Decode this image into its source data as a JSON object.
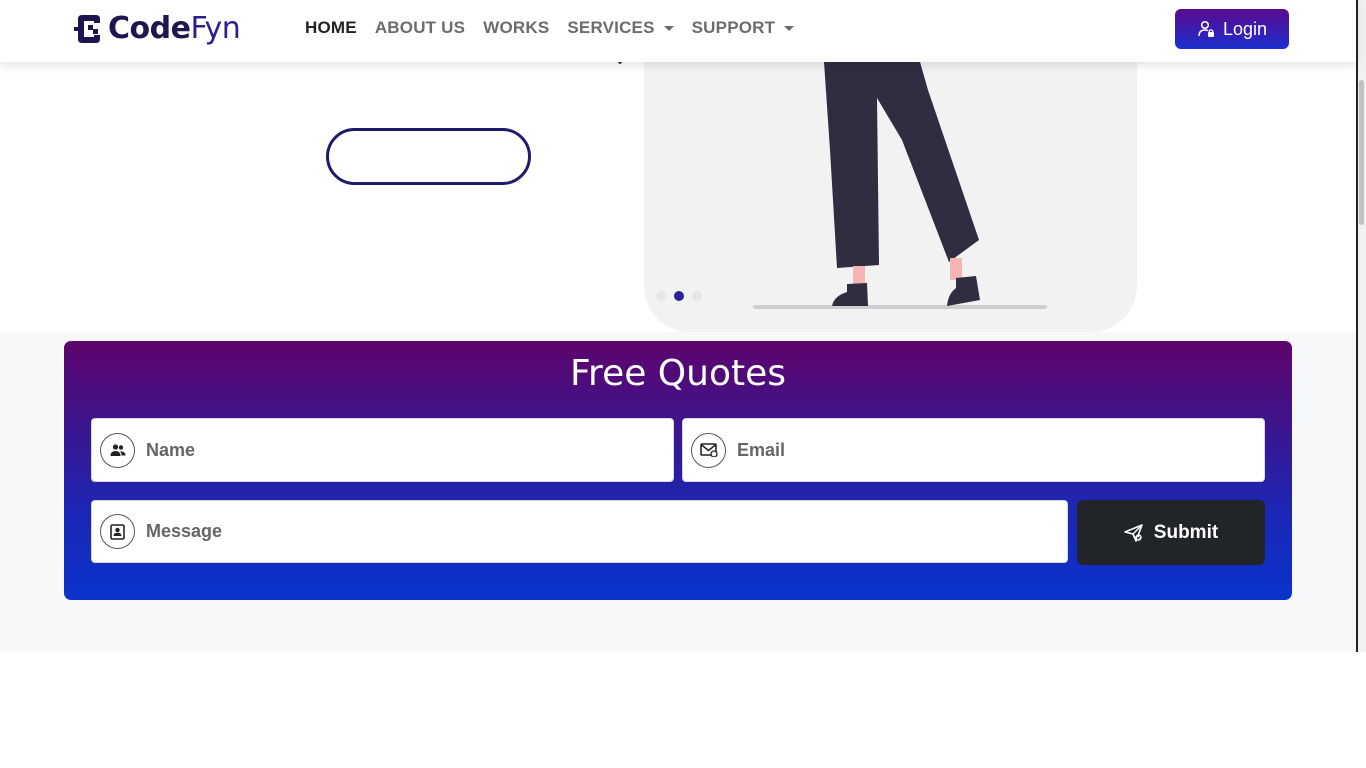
{
  "brand": {
    "name_part1": "Code",
    "name_part2": "Fyn"
  },
  "nav": {
    "items": [
      {
        "label": "HOME",
        "active": true,
        "dropdown": false
      },
      {
        "label": "ABOUT US",
        "active": false,
        "dropdown": false
      },
      {
        "label": "WORKS",
        "active": false,
        "dropdown": false
      },
      {
        "label": "SERVICES",
        "active": false,
        "dropdown": true
      },
      {
        "label": "SUPPORT",
        "active": false,
        "dropdown": true
      }
    ],
    "login_label": "Login"
  },
  "hero": {
    "carousel_active_index": 1,
    "carousel_count": 3
  },
  "quote": {
    "title": "Free Quotes",
    "name_placeholder": "Name",
    "email_placeholder": "Email",
    "message_placeholder": "Message",
    "submit_label": "Submit"
  },
  "colors": {
    "brand_dark": "#1e1650",
    "accent_purple": "#5e046b",
    "accent_blue": "#0a33cc",
    "submit_bg": "#212529"
  },
  "icons": [
    "user-group-icon",
    "envelope-icon",
    "id-card-icon",
    "send-icon",
    "user-lock-icon"
  ]
}
